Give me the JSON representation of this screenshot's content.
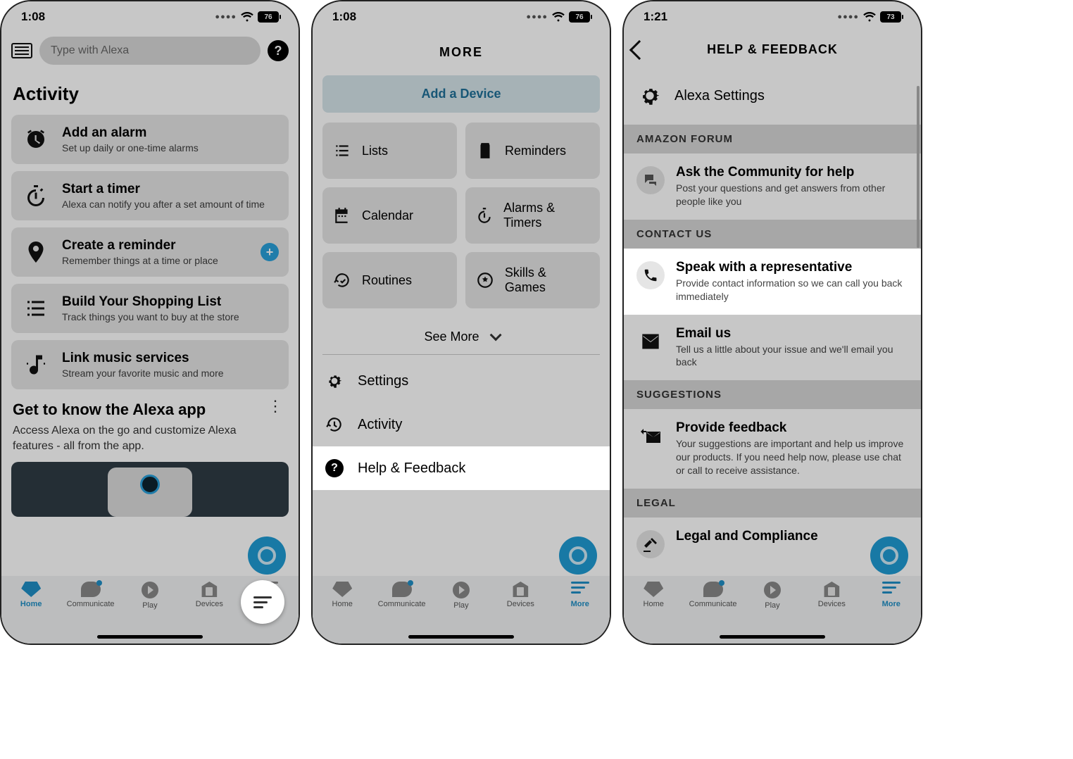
{
  "screen1": {
    "status": {
      "time": "1:08",
      "battery": "76"
    },
    "search_placeholder": "Type with Alexa",
    "section_title": "Activity",
    "cards": [
      {
        "title": "Add an alarm",
        "subtitle": "Set up daily or one-time alarms"
      },
      {
        "title": "Start a timer",
        "subtitle": "Alexa can notify you after a set amount of time"
      },
      {
        "title": "Create a reminder",
        "subtitle": "Remember things at a time or place"
      },
      {
        "title": "Build Your Shopping List",
        "subtitle": "Track things you want to buy at the store"
      },
      {
        "title": "Link music services",
        "subtitle": "Stream your favorite music and more"
      }
    ],
    "tip": {
      "title": "Get to know the Alexa app",
      "subtitle": "Access Alexa on the go and customize Alexa features - all from the app."
    },
    "tabs": {
      "home": "Home",
      "communicate": "Communicate",
      "play": "Play",
      "devices": "Devices",
      "more": "More"
    }
  },
  "screen2": {
    "status": {
      "time": "1:08",
      "battery": "76"
    },
    "title": "MORE",
    "add_device": "Add a Device",
    "grid": {
      "lists": "Lists",
      "reminders": "Reminders",
      "calendar": "Calendar",
      "alarms": "Alarms & Timers",
      "routines": "Routines",
      "skills": "Skills & Games"
    },
    "see_more": "See More",
    "menu": {
      "settings": "Settings",
      "activity": "Activity",
      "help": "Help & Feedback"
    },
    "tabs": {
      "home": "Home",
      "communicate": "Communicate",
      "play": "Play",
      "devices": "Devices",
      "more": "More"
    }
  },
  "screen3": {
    "status": {
      "time": "1:21",
      "battery": "73"
    },
    "title": "HELP & FEEDBACK",
    "alexa_settings": "Alexa Settings",
    "sections": {
      "forum": {
        "header": "AMAZON FORUM",
        "item": {
          "title": "Ask the Community for help",
          "subtitle": "Post your questions and get answers from other people like you"
        }
      },
      "contact": {
        "header": "CONTACT US",
        "speak": {
          "title": "Speak with a representative",
          "subtitle": "Provide contact information so we can call you back immediately"
        },
        "email": {
          "title": "Email us",
          "subtitle": "Tell us a little about your issue and we'll email you back"
        }
      },
      "suggestions": {
        "header": "SUGGESTIONS",
        "feedback": {
          "title": "Provide feedback",
          "subtitle": "Your suggestions are important and help us improve our products. If you need help now, please use chat or call to receive assistance."
        }
      },
      "legal": {
        "header": "LEGAL",
        "item": {
          "title": "Legal and Compliance"
        }
      }
    },
    "tabs": {
      "home": "Home",
      "communicate": "Communicate",
      "play": "Play",
      "devices": "Devices",
      "more": "More"
    }
  }
}
